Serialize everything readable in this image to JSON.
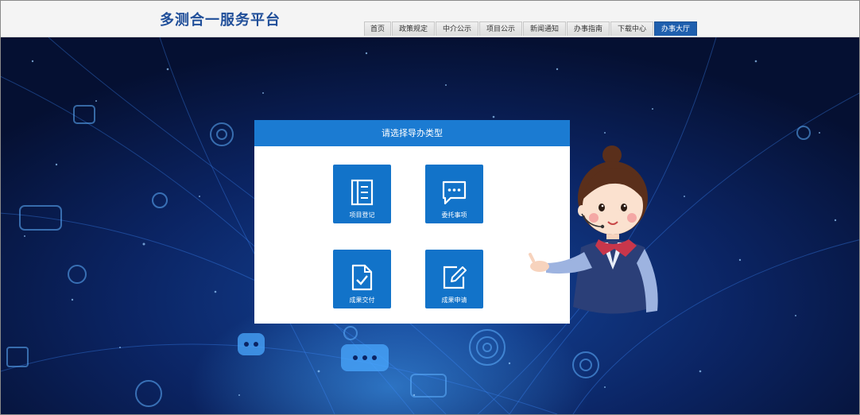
{
  "header": {
    "site_title": "多测合一服务平台",
    "nav": [
      {
        "label": "首页",
        "active": false
      },
      {
        "label": "政策规定",
        "active": false
      },
      {
        "label": "中介公示",
        "active": false
      },
      {
        "label": "项目公示",
        "active": false
      },
      {
        "label": "新闻通知",
        "active": false
      },
      {
        "label": "办事指南",
        "active": false
      },
      {
        "label": "下载中心",
        "active": false
      },
      {
        "label": "办事大厅",
        "active": true
      }
    ]
  },
  "panel": {
    "title": "请选择导办类型",
    "tiles": [
      {
        "label": "项目登记",
        "icon": "document-list-icon"
      },
      {
        "label": "委托事项",
        "icon": "chat-bubble-icon"
      },
      {
        "label": "成果交付",
        "icon": "document-check-icon"
      },
      {
        "label": "成果申请",
        "icon": "edit-icon"
      }
    ]
  },
  "colors": {
    "accent": "#1b7bd2",
    "tile": "#1273c9",
    "title": "#1f4e99",
    "nav_active": "#1f5fae"
  }
}
